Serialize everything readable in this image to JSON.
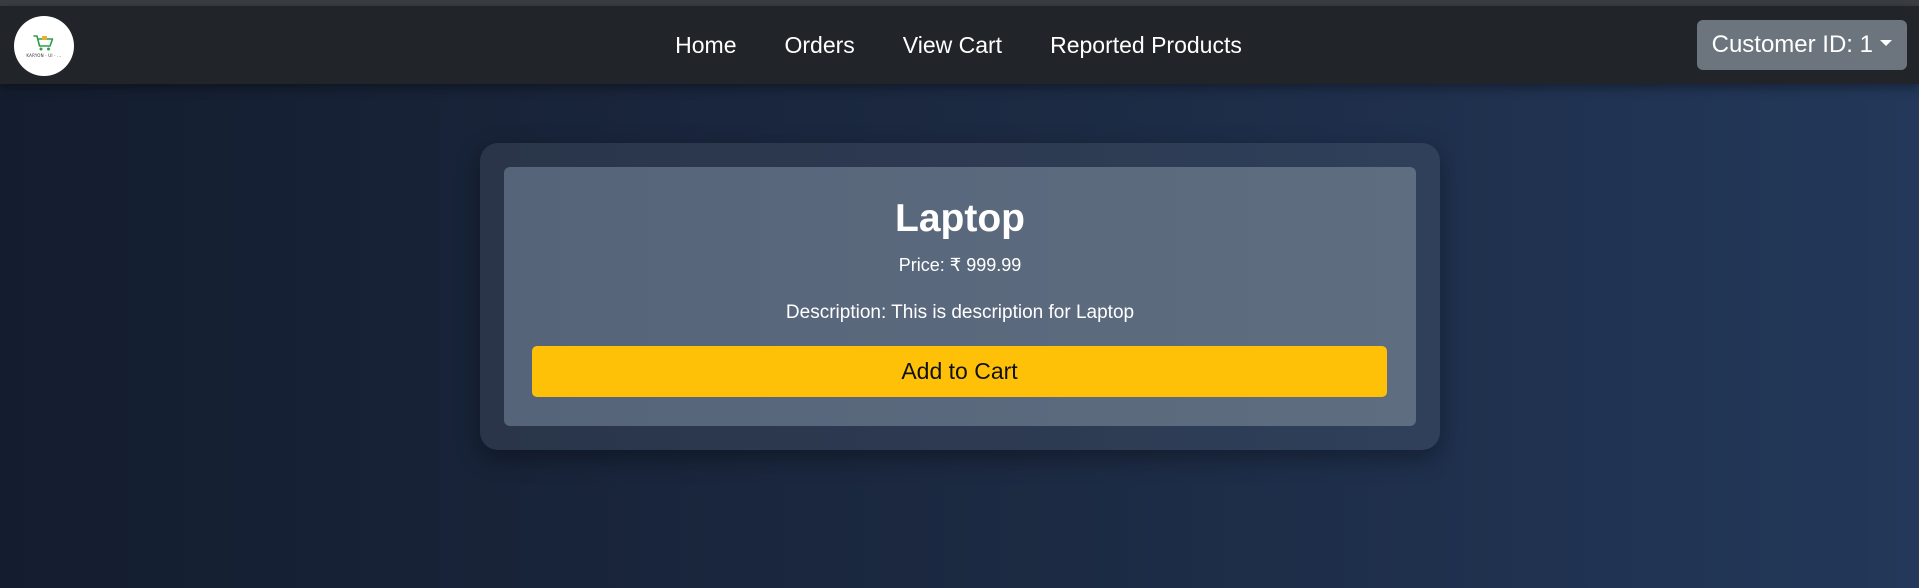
{
  "navbar": {
    "logo": {
      "icon": "shopping-cart-icon",
      "text": "KARYON · UI · ..."
    },
    "links": [
      "Home",
      "Orders",
      "View Cart",
      "Reported Products"
    ],
    "customer_dropdown": {
      "label": "Customer ID: 1"
    }
  },
  "product": {
    "name": "Laptop",
    "price": "Price: ₹ 999.99",
    "description": "Description: This is description for Laptop",
    "add_button": "Add to Cart"
  },
  "colors": {
    "navbar_bg": "#212529",
    "accent": "#ffc107",
    "dropdown_bg": "#6c757d",
    "card_bg": "#5a687c"
  }
}
